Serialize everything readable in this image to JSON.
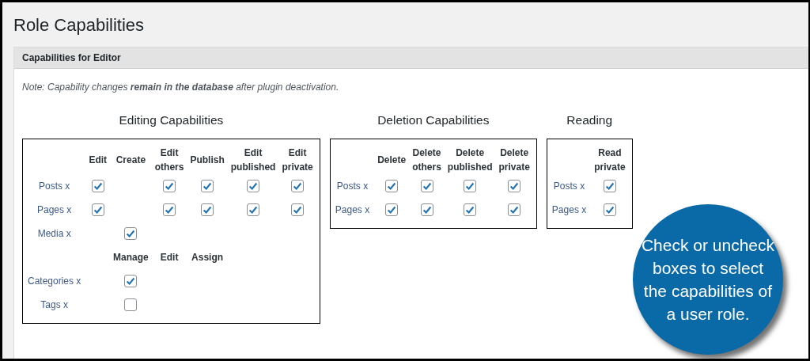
{
  "page_title": "Role Capabilities",
  "panel": {
    "title": "Capabilities for Editor",
    "note": "*Note:* *Capability changes* **remain in the database** *after plugin deactivation.*"
  },
  "groups": [
    {
      "title": "Editing Capabilities",
      "columns": [
        "Edit",
        "Create",
        "Edit others",
        "Publish",
        "Edit published",
        "Edit private"
      ],
      "rows": [
        {
          "kind": "item",
          "label": "Posts x",
          "cells": [
            {
              "kind": "checkbox",
              "checked": true
            },
            {
              "kind": "empty"
            },
            {
              "kind": "checkbox",
              "checked": true
            },
            {
              "kind": "checkbox",
              "checked": true
            },
            {
              "kind": "checkbox",
              "checked": true
            },
            {
              "kind": "checkbox",
              "checked": true
            }
          ]
        },
        {
          "kind": "item",
          "label": "Pages x",
          "cells": [
            {
              "kind": "checkbox",
              "checked": true
            },
            {
              "kind": "empty"
            },
            {
              "kind": "checkbox",
              "checked": true
            },
            {
              "kind": "checkbox",
              "checked": true
            },
            {
              "kind": "checkbox",
              "checked": true
            },
            {
              "kind": "checkbox",
              "checked": true
            }
          ]
        },
        {
          "kind": "item",
          "label": "Media x",
          "cells": [
            {
              "kind": "empty"
            },
            {
              "kind": "checkbox",
              "checked": true
            },
            {
              "kind": "empty"
            },
            {
              "kind": "empty"
            },
            {
              "kind": "empty"
            },
            {
              "kind": "empty"
            }
          ]
        },
        {
          "kind": "header",
          "cells": [
            {
              "kind": "empty"
            },
            {
              "kind": "heading",
              "text": "Manage"
            },
            {
              "kind": "heading",
              "text": "Edit"
            },
            {
              "kind": "heading",
              "text": "Assign"
            },
            {
              "kind": "empty"
            },
            {
              "kind": "empty"
            }
          ]
        },
        {
          "kind": "item",
          "label": "Categories x",
          "cells": [
            {
              "kind": "empty"
            },
            {
              "kind": "checkbox",
              "checked": true
            },
            {
              "kind": "empty"
            },
            {
              "kind": "empty"
            },
            {
              "kind": "empty"
            },
            {
              "kind": "empty"
            }
          ]
        },
        {
          "kind": "item",
          "label": "Tags x",
          "cells": [
            {
              "kind": "empty"
            },
            {
              "kind": "checkbox",
              "checked": false
            },
            {
              "kind": "empty"
            },
            {
              "kind": "empty"
            },
            {
              "kind": "empty"
            },
            {
              "kind": "empty"
            }
          ]
        }
      ]
    },
    {
      "title": "Deletion Capabilities",
      "columns": [
        "Delete",
        "Delete others",
        "Delete published",
        "Delete private"
      ],
      "rows": [
        {
          "kind": "item",
          "label": "Posts x",
          "cells": [
            {
              "kind": "checkbox",
              "checked": true
            },
            {
              "kind": "checkbox",
              "checked": true
            },
            {
              "kind": "checkbox",
              "checked": true
            },
            {
              "kind": "checkbox",
              "checked": true
            }
          ]
        },
        {
          "kind": "item",
          "label": "Pages x",
          "cells": [
            {
              "kind": "checkbox",
              "checked": true
            },
            {
              "kind": "checkbox",
              "checked": true
            },
            {
              "kind": "checkbox",
              "checked": true
            },
            {
              "kind": "checkbox",
              "checked": true
            }
          ]
        }
      ]
    },
    {
      "title": "Reading",
      "columns": [
        "Read private"
      ],
      "rows": [
        {
          "kind": "item",
          "label": "Posts x",
          "cells": [
            {
              "kind": "checkbox",
              "checked": true
            }
          ]
        },
        {
          "kind": "item",
          "label": "Pages x",
          "cells": [
            {
              "kind": "checkbox",
              "checked": true
            }
          ]
        }
      ]
    }
  ],
  "callout": {
    "text": "Check or uncheck boxes to select the capabilities of a user role."
  }
}
